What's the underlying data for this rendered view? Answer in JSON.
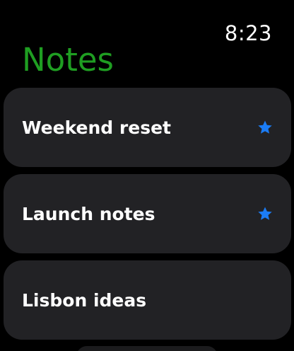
{
  "status_bar": {
    "time": "8:23"
  },
  "header": {
    "title": "Notes"
  },
  "colors": {
    "title_accent": "#1f9e22",
    "star_accent": "#1b7cf5",
    "card_bg": "#222225"
  },
  "notes": [
    {
      "label": "Weekend reset",
      "starred": true,
      "star_icon": "star-icon"
    },
    {
      "label": "Launch notes",
      "starred": true,
      "star_icon": "star-icon"
    },
    {
      "label": "Lisbon ideas",
      "starred": false
    }
  ]
}
